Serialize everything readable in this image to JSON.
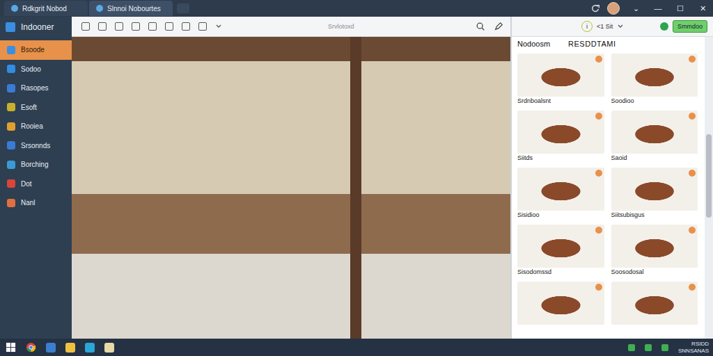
{
  "window": {
    "tabs": [
      {
        "label": "Rdkgrit Nobod",
        "selected": false
      },
      {
        "label": "Slnnoi Nobourtes",
        "selected": true
      }
    ],
    "controls": [
      "⌄",
      "—",
      "☐",
      "✕"
    ]
  },
  "sidebar": {
    "title": "Indooner",
    "items": [
      {
        "label": "Bsoode",
        "selected": true,
        "color": "#3b8ee0"
      },
      {
        "label": "Sodoo",
        "selected": false,
        "color": "#2f8de4"
      },
      {
        "label": "Rasopes",
        "selected": false,
        "color": "#3a7bd5"
      },
      {
        "label": "Esoft",
        "selected": false,
        "color": "#c8b02a"
      },
      {
        "label": "Rooiea",
        "selected": false,
        "color": "#e0a030"
      },
      {
        "label": "Srsonnds",
        "selected": false,
        "color": "#3a7bd5"
      },
      {
        "label": "Borching",
        "selected": false,
        "color": "#3a9ad5"
      },
      {
        "label": "Dot",
        "selected": false,
        "color": "#d9453b"
      },
      {
        "label": "Nanl",
        "selected": false,
        "color": "#e07040"
      }
    ]
  },
  "toolbar": {
    "placeholder": "Srvlotoxd"
  },
  "panel": {
    "info": "i",
    "filter": "<1 Sit",
    "button": "Smmdoo",
    "title": "Nodoosm",
    "subtitle": "RESDDTAMI",
    "cards": [
      {
        "kind": "captioned",
        "caption": "Srdnboalsnt"
      },
      {
        "kind": "captioned",
        "caption": "Soodioo"
      },
      {
        "kind": "captioned",
        "caption": "Siitds"
      },
      {
        "kind": "captioned",
        "caption": "Saoid"
      },
      {
        "kind": "captioned",
        "caption": "Sisidioo"
      },
      {
        "kind": "captioned",
        "caption": "Siitsubisgus"
      },
      {
        "kind": "captioned",
        "caption": "Sisodomssd"
      },
      {
        "kind": "captioned",
        "caption": "Soosodosal"
      },
      {
        "kind": "image"
      },
      {
        "kind": "image"
      }
    ]
  },
  "taskbar": {
    "time": "RSIDD",
    "date": "SNNSANAS"
  }
}
